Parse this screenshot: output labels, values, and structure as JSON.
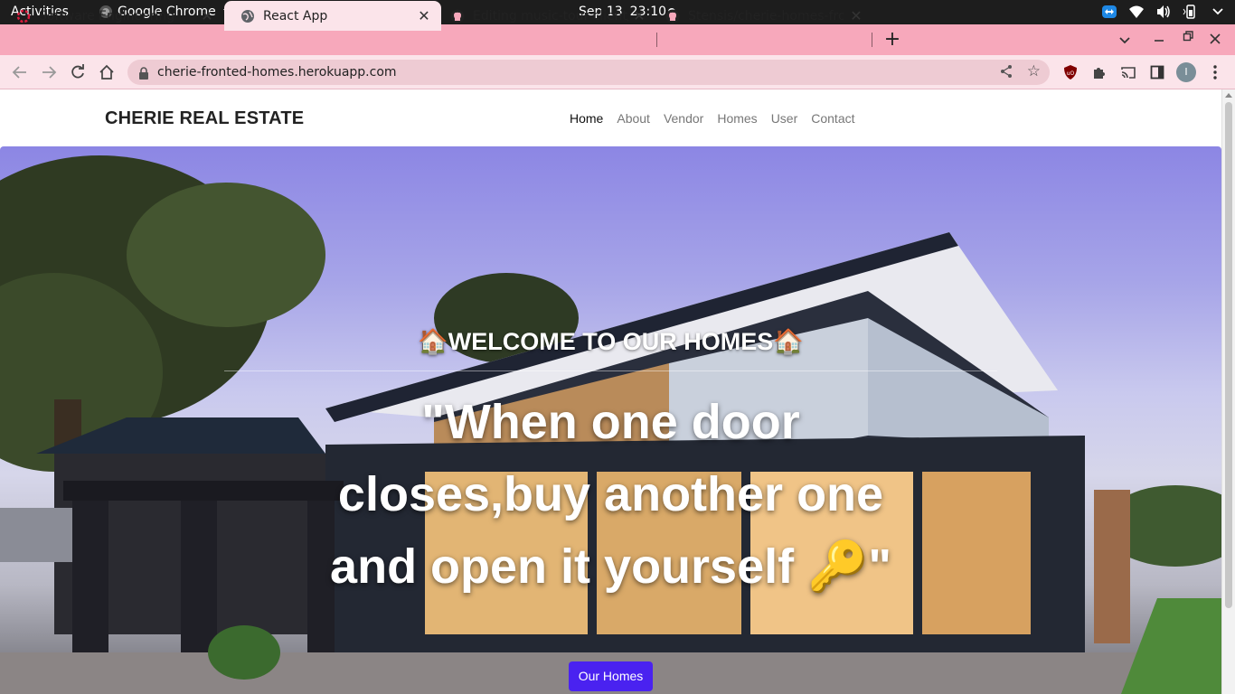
{
  "system_bar": {
    "activities": "Activities",
    "app_name": "Google Chrome",
    "date": "Sep 13",
    "time": "23:10"
  },
  "tabs": [
    {
      "label": "Software Engineering 59-",
      "favicon": "spinner-icon",
      "active": false
    },
    {
      "label": "React App",
      "favicon": "globe-icon",
      "active": true
    },
    {
      "label": "Editing music-tour-client/",
      "favicon": "github-icon",
      "active": false
    },
    {
      "label": "Stensis/cherie-homes-fro",
      "favicon": "github-icon",
      "active": false
    }
  ],
  "omnibox": {
    "url": "cherie-fronted-homes.herokuapp.com"
  },
  "profile_initial": "I",
  "site": {
    "brand": "CHERIE REAL ESTATE",
    "nav": [
      {
        "label": "Home",
        "active": true
      },
      {
        "label": "About",
        "active": false
      },
      {
        "label": "Vendor",
        "active": false
      },
      {
        "label": "Homes",
        "active": false
      },
      {
        "label": "User",
        "active": false
      },
      {
        "label": "Contact",
        "active": false
      }
    ],
    "hero": {
      "welcome": "🏠WELCOME TO OUR HOMES🏠",
      "quote_lines": [
        "\"When one door",
        "closes,buy another one",
        "and open it yourself 🔑\""
      ],
      "cta": "Our Homes"
    }
  },
  "colors": {
    "tab_strip": "#f7a8bb",
    "toolbar": "#fbe4ea",
    "cta": "#4a22f0"
  }
}
